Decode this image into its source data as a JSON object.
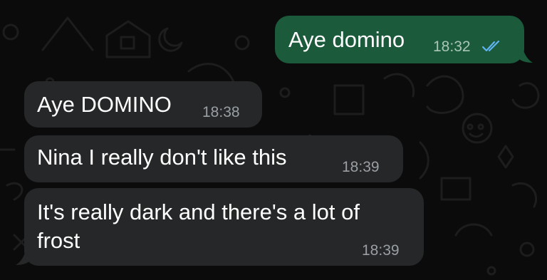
{
  "theme": {
    "incoming_bg": "#262728",
    "outgoing_bg": "#1c5a3c",
    "tick_color": "#5fb3f0",
    "wallpaper_bg": "#0b0b0b"
  },
  "messages": [
    {
      "direction": "outgoing",
      "text": "Aye domino",
      "time": "18:32",
      "status": "read-double-check-icon"
    },
    {
      "direction": "incoming",
      "text": "Aye DOMINO",
      "time": "18:38"
    },
    {
      "direction": "incoming",
      "text": "Nina I really don't like this",
      "time": "18:39"
    },
    {
      "direction": "incoming",
      "lines": [
        "It's really dark and there's a lot of",
        "frost"
      ],
      "time": "18:39"
    }
  ]
}
